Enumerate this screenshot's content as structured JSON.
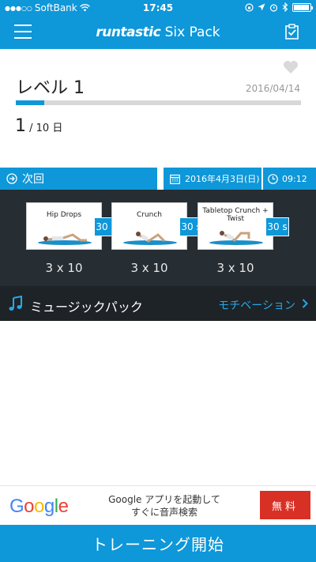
{
  "status_bar": {
    "signal": "●●●○○",
    "carrier": "SoftBank",
    "time": "17:45"
  },
  "header": {
    "brand": "runtastic",
    "title": "Six Pack"
  },
  "level": {
    "title": "レベル 1",
    "date": "2016/04/14",
    "progress_fraction": 0.1,
    "current_day": "1",
    "total_days": " / 10 日"
  },
  "next": {
    "label": "次回",
    "date": "2016年4月3日(日)",
    "time": "09:12"
  },
  "exercises": [
    {
      "name": "Hip Drops",
      "duration": "30 s",
      "reps": "3 x 10"
    },
    {
      "name": "Crunch",
      "duration": "30 s",
      "reps": "3 x 10"
    },
    {
      "name": "Tabletop Crunch + Twist",
      "duration": "30 s",
      "reps": "3 x 10"
    }
  ],
  "music": {
    "label": "ミュージックパック",
    "value": "モチベーション"
  },
  "ad": {
    "logo_letters": [
      "G",
      "o",
      "o",
      "g",
      "l",
      "e"
    ],
    "logo_colors": [
      "#4285F4",
      "#EA4335",
      "#FBBC05",
      "#4285F4",
      "#34A853",
      "#EA4335"
    ],
    "line1": "Google アプリを起動して",
    "line2": "すぐに音声検索",
    "button": "無料"
  },
  "start_button": "トレーニング開始",
  "colors": {
    "brand_blue": "#0e97d9",
    "dark_panel": "#262d33",
    "music_bar": "#1e2327",
    "ad_red": "#d93025"
  }
}
